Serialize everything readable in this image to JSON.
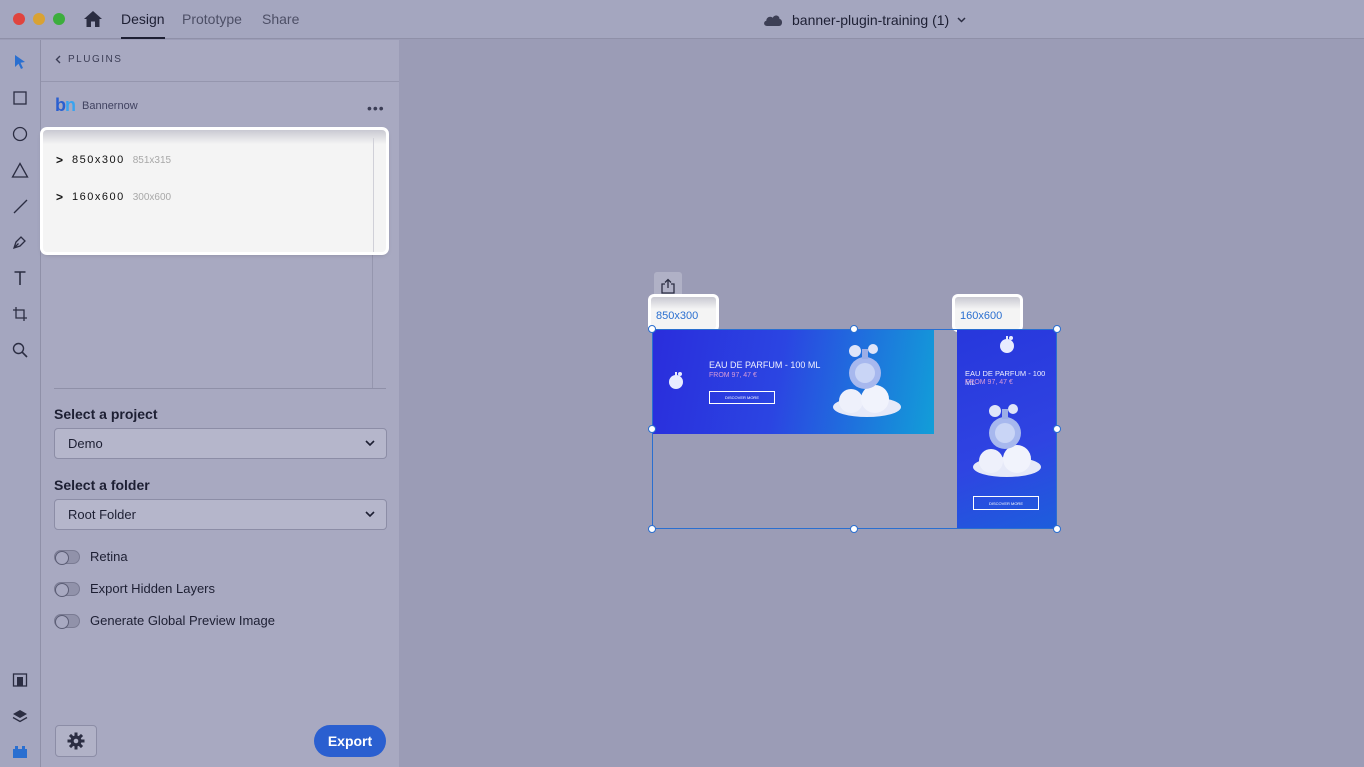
{
  "titlebar": {
    "tabs": [
      {
        "label": "Design",
        "active": true
      },
      {
        "label": "Prototype",
        "active": false
      },
      {
        "label": "Share",
        "active": false
      }
    ],
    "document_title": "banner-plugin-training (1)"
  },
  "panel": {
    "back_label": "PLUGINS",
    "plugin_name": "Bannernow",
    "artboards": [
      {
        "name": "850x300",
        "size": "851x315"
      },
      {
        "name": "160x600",
        "size": "300x600"
      }
    ],
    "project_label": "Select a project",
    "project_value": "Demo",
    "folder_label": "Select a folder",
    "folder_value": "Root Folder",
    "toggles": [
      {
        "label": "Retina",
        "on": false
      },
      {
        "label": "Export Hidden Layers",
        "on": false
      },
      {
        "label": "Generate Global Preview Image",
        "on": false
      }
    ],
    "export_label": "Export"
  },
  "canvas": {
    "artboard_labels": [
      "850x300",
      "160x600"
    ],
    "banner": {
      "title": "EAU DE PARFUM - 100 ML",
      "price": "FROM 97, 47 €",
      "cta": "DISCOVER MORE"
    }
  },
  "colors": {
    "accent": "#2a5fd0",
    "canvas_bg": "#9b9cb6",
    "panel_bg": "#a8a9c1"
  }
}
